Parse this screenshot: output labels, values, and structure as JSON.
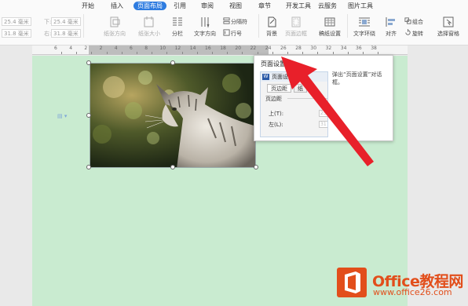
{
  "menu": {
    "tabs": [
      {
        "label": "开始"
      },
      {
        "label": "插入"
      },
      {
        "label": "页面布局",
        "active": true
      },
      {
        "label": "引用"
      },
      {
        "label": "审阅"
      },
      {
        "label": "视图"
      },
      {
        "label": "章节"
      },
      {
        "label": "开发工具"
      },
      {
        "label": "云服务"
      },
      {
        "label": "图片工具"
      }
    ]
  },
  "margins": {
    "top_label": "上:",
    "top_value": "25.4 毫米",
    "bottom_label": "下:",
    "bottom_value": "25.4 毫米",
    "left_label": "左:",
    "left_value": "31.8 毫米",
    "right_label": "右:",
    "right_value": "31.8 毫米"
  },
  "ribbon": {
    "orientation": "纸张方向",
    "paper_size": "纸张大小",
    "columns": "分栏",
    "text_direction": "文字方向",
    "breaks": "分隔符",
    "line_numbers": "行号",
    "background": "背景",
    "page_border": "页面边框",
    "paper_setup": "稿纸设置",
    "text_wrap": "文字环绕",
    "align": "对齐",
    "group": "组合",
    "rotate": "旋转",
    "selection_pane": "选择窗格"
  },
  "ruler": {
    "numbers": [
      "6",
      "4",
      "2",
      "2",
      "4",
      "6",
      "8",
      "10",
      "12",
      "14",
      "16",
      "18",
      "20",
      "22",
      "24",
      "26",
      "28",
      "30",
      "32",
      "34",
      "36",
      "38"
    ]
  },
  "tooltip": {
    "title": "页面设置",
    "description": "弹出“页面设置”对话框。",
    "mini": {
      "window_title": "页面设置",
      "tab_margins": "页边距",
      "tab_paper": "纸",
      "group": "页边距",
      "top_label": "上(T):",
      "left_label": "左(L):",
      "top_value": "25",
      "left_value": "31"
    }
  },
  "watermark": {
    "line1": "Office教程网",
    "line2": "www.office26.com"
  },
  "colors": {
    "accent": "#2e7ce0",
    "page_bg": "#c9ebd0",
    "arrow": "#e8202a",
    "logo": "#e24e1b"
  }
}
